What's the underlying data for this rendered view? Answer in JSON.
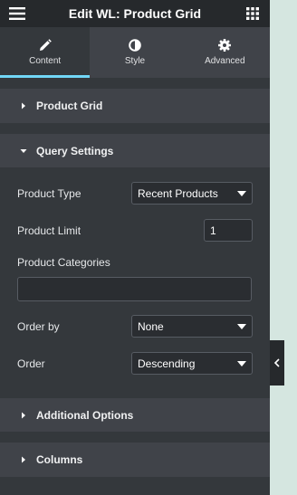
{
  "header": {
    "title": "Edit WL: Product Grid"
  },
  "tabs": [
    {
      "label": "Content",
      "icon": "pencil-icon"
    },
    {
      "label": "Style",
      "icon": "half-circle-icon"
    },
    {
      "label": "Advanced",
      "icon": "gear-icon"
    }
  ],
  "sections": {
    "product_grid": "Product Grid",
    "query_settings": "Query Settings",
    "additional_options": "Additional Options",
    "columns": "Columns"
  },
  "query": {
    "product_type_label": "Product Type",
    "product_type_value": "Recent Products",
    "product_limit_label": "Product Limit",
    "product_limit_value": "1",
    "product_categories_label": "Product Categories",
    "product_categories_value": "",
    "order_by_label": "Order by",
    "order_by_value": "None",
    "order_label": "Order",
    "order_value": "Descending"
  },
  "colors": {
    "accent": "#71d7f7",
    "panel": "#34383c",
    "header": "#26292c"
  }
}
